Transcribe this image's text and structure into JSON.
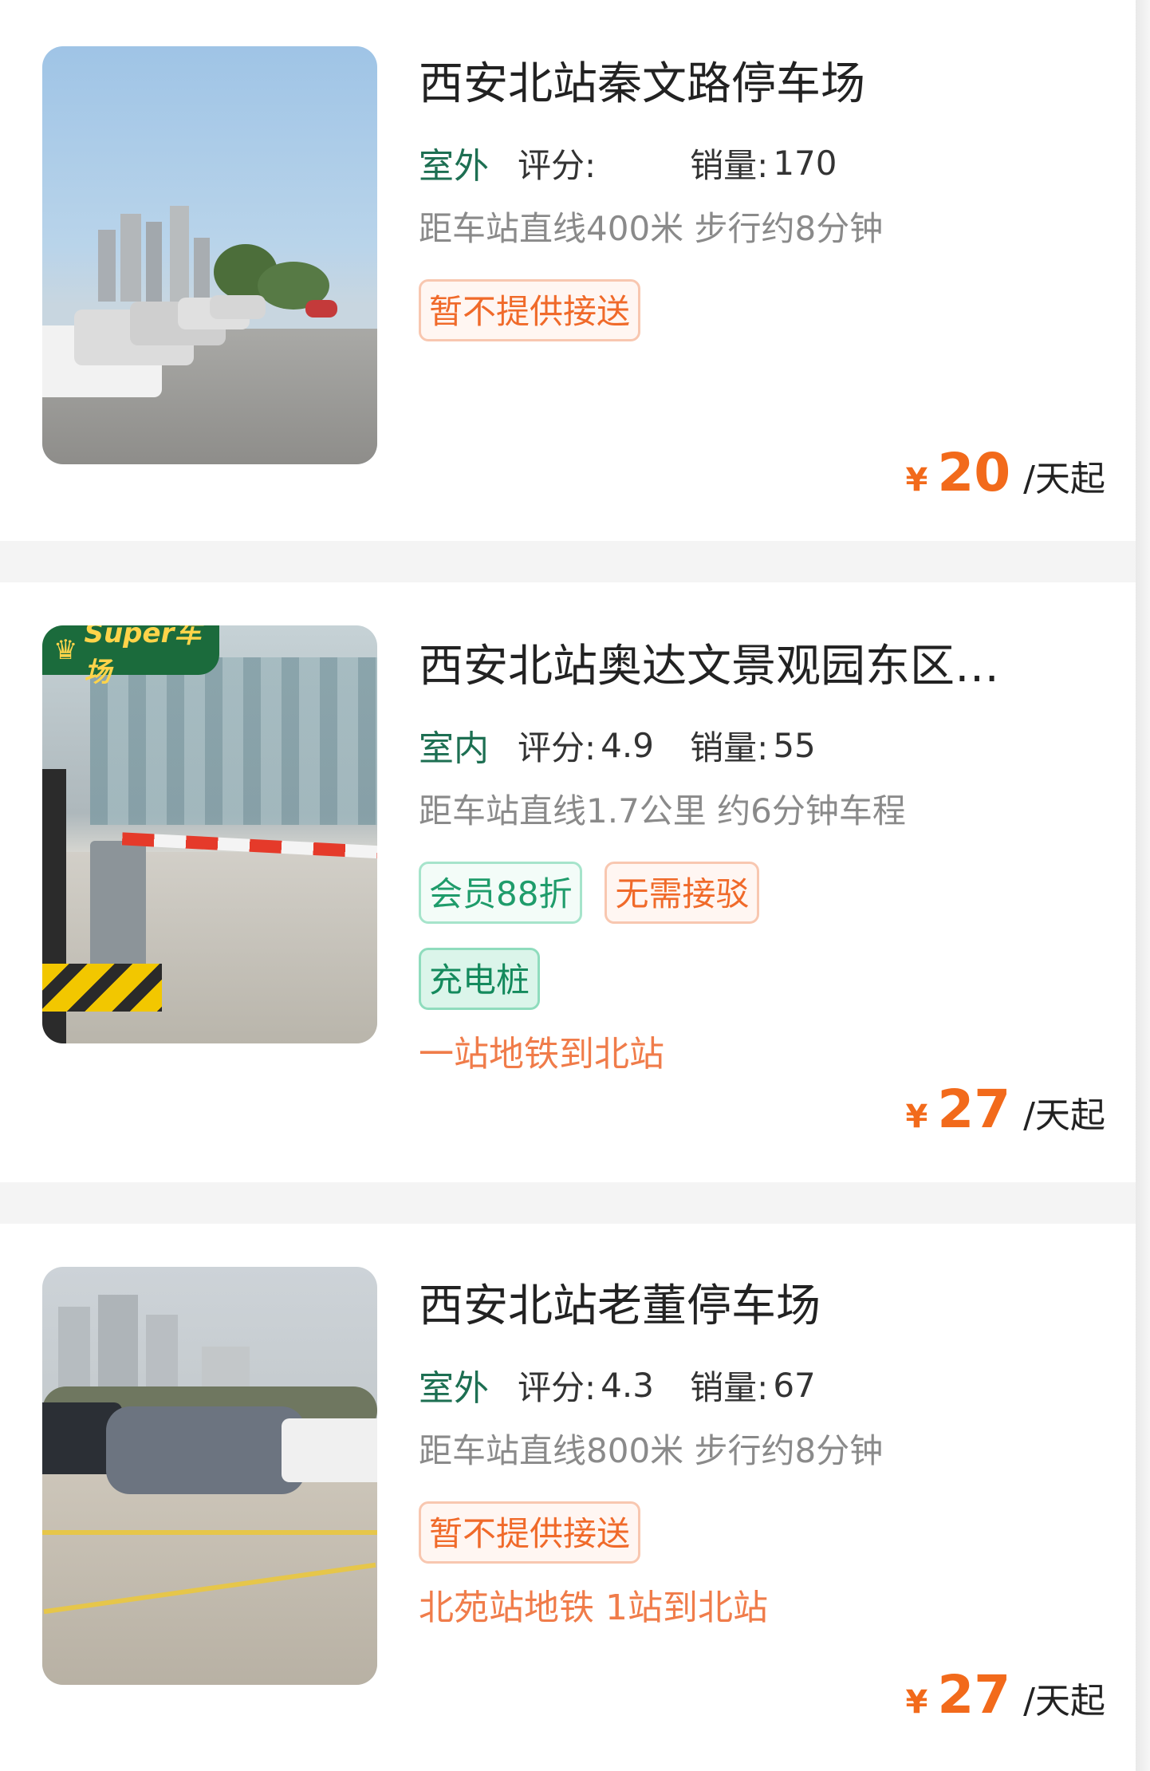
{
  "listings": [
    {
      "title": "西安北站秦文路停车场",
      "env": "室外",
      "rating_label": "评分:",
      "rating": "",
      "sales_label": "销量:",
      "sales": "170",
      "distance": "距车站直线400米 步行约8分钟",
      "tags": [
        "暂不提供接送"
      ],
      "promo": "",
      "currency": "¥",
      "price": "20",
      "price_unit": "/天起",
      "badge": ""
    },
    {
      "title": "西安北站奥达文景观园东区…",
      "env": "室内",
      "rating_label": "评分:",
      "rating": "4.9",
      "sales_label": "销量:",
      "sales": "55",
      "distance": "距车站直线1.7公里 约6分钟车程",
      "tags": [
        "会员88折",
        "无需接驳",
        "充电桩"
      ],
      "promo": "一站地铁到北站",
      "currency": "¥",
      "price": "27",
      "price_unit": "/天起",
      "badge": "Super车场"
    },
    {
      "title": "西安北站老董停车场",
      "env": "室外",
      "rating_label": "评分:",
      "rating": "4.3",
      "sales_label": "销量:",
      "sales": "67",
      "distance": "距车站直线800米 步行约8分钟",
      "tags": [
        "暂不提供接送"
      ],
      "promo": "北苑站地铁 1站到北站",
      "currency": "¥",
      "price": "27",
      "price_unit": "/天起",
      "badge": ""
    }
  ],
  "colors": {
    "accent_price": "#f26a1b",
    "tag_orange": "#f06a2a",
    "tag_green": "#1f9c6b",
    "badge_bg": "#1b6b3c",
    "badge_text": "#ffd44a"
  },
  "icons": {
    "crown": "crown-icon"
  }
}
